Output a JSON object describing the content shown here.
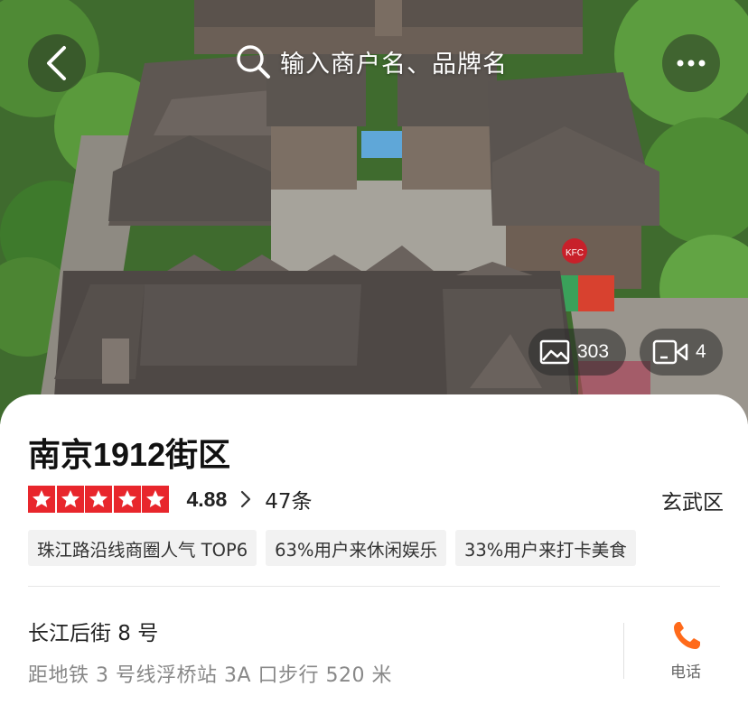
{
  "header": {
    "search_placeholder": "输入商户名、品牌名"
  },
  "hero": {
    "kfc_sign": "KFC",
    "photo_count": "303",
    "video_count": "4"
  },
  "poi": {
    "name": "南京1912街区",
    "stars": 5,
    "score": "4.88",
    "review_count": "47条",
    "district": "玄武区",
    "tags": [
      "珠江路沿线商圈人气 TOP6",
      "63%用户来休闲娱乐",
      "33%用户来打卡美食"
    ],
    "address": "长江后街 8 号",
    "distance": "距地铁 3 号线浮桥站 3A 口步行 520 米",
    "phone_label": "电话"
  },
  "colors": {
    "star_red": "#e8262c",
    "phone_orange": "#ff6a1a"
  },
  "icons": [
    "back-arrow-icon",
    "search-icon",
    "more-dots-icon",
    "image-icon",
    "video-camera-icon",
    "star-icon",
    "chevron-right-icon",
    "phone-icon"
  ]
}
